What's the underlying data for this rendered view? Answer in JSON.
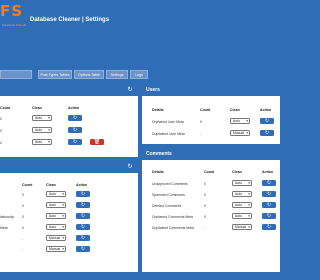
{
  "header": {
    "logo": "FS",
    "logo_sub": "Facebook Friends",
    "title": "Database Cleaner | Settings"
  },
  "tabs": [
    "",
    "Post Types Tables",
    "Options Table",
    "Settings",
    "Logs"
  ],
  "users": {
    "title": "Users",
    "cols": {
      "details": "Details",
      "count": "Count",
      "clean": "Clean",
      "action": "Action"
    },
    "rows": [
      {
        "details": "Orphaned User Meta",
        "count": "0",
        "clean": "Auto"
      },
      {
        "details": "Duplicated User Meta",
        "count": "-",
        "clean": "Manual"
      }
    ]
  },
  "left_top": {
    "cols": {
      "count": "Count",
      "clean": "Clean",
      "action": "Action"
    },
    "rows": [
      {
        "count": "0",
        "clean": "Auto"
      },
      {
        "count": "0",
        "clean": "Auto"
      },
      {
        "count": "2",
        "clean": "Auto"
      }
    ]
  },
  "left_bottom": {
    "cols": {
      "count": "Count",
      "clean": "Clean",
      "action": "Action"
    },
    "rows": [
      {
        "details": "",
        "count": "0",
        "clean": "Auto"
      },
      {
        "details": "",
        "count": "0",
        "clean": "Auto"
      },
      {
        "details": "lationship",
        "count": "0",
        "clean": "Auto"
      },
      {
        "details": "Meta",
        "count": "0",
        "clean": "Auto"
      },
      {
        "details": "",
        "count": "-",
        "clean": "Manual"
      },
      {
        "details": "",
        "count": "-",
        "clean": "Manual"
      }
    ]
  },
  "comments": {
    "title": "Comments",
    "cols": {
      "details": "Details",
      "count": "Count",
      "clean": "Clean",
      "action": "Action"
    },
    "rows": [
      {
        "details": "Unapproved Comments",
        "count": "0",
        "clean": "Auto"
      },
      {
        "details": "Spammed Comments",
        "count": "0",
        "clean": "Auto"
      },
      {
        "details": "Deleted Comments",
        "count": "0",
        "clean": "Auto"
      },
      {
        "details": "Orphaned Comments Meta",
        "count": "0",
        "clean": "Auto"
      },
      {
        "details": "Duplicated Comments Meta",
        "count": "-",
        "clean": "Manual"
      }
    ]
  },
  "icons": {
    "refresh": "refresh-icon",
    "trash": "trash-icon",
    "caret": "caret-down-icon"
  },
  "colors": {
    "primary": "#2f6db7",
    "accent": "#ff7a1a",
    "danger": "#c0392b"
  }
}
